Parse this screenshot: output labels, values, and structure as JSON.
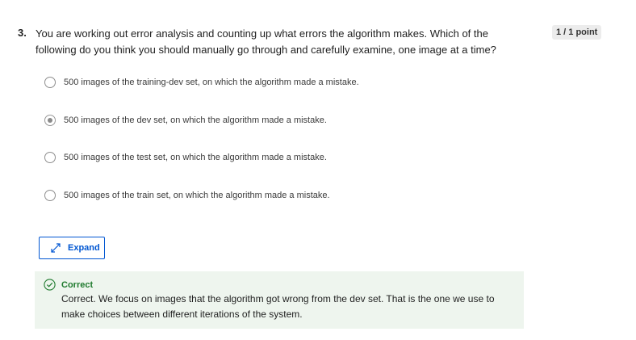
{
  "question": {
    "number": "3.",
    "text": "You are working out error analysis and counting up what errors the algorithm makes. Which of the following do you think you should manually go through and carefully examine, one image at a time?",
    "points": "1 / 1 point"
  },
  "options": [
    {
      "label": "500 images of the training-dev set, on which the algorithm made a mistake.",
      "selected": false
    },
    {
      "label": "500 images of the dev set, on which the algorithm made a mistake.",
      "selected": true
    },
    {
      "label": "500 images of the test set, on which the algorithm made a mistake.",
      "selected": false
    },
    {
      "label": "500 images of the train set, on which the algorithm made a mistake.",
      "selected": false
    }
  ],
  "expand": {
    "label": "Expand",
    "icon": "expand-arrows-icon"
  },
  "feedback": {
    "title": "Correct",
    "text": "Correct. We focus on images that the algorithm got wrong from the dev set. That is the one we use to make choices between different iterations of the system.",
    "icon": "check-circle-icon"
  },
  "colors": {
    "link": "#0056d2",
    "success": "#1f7a2e",
    "feedback_bg": "#eef5ee"
  }
}
